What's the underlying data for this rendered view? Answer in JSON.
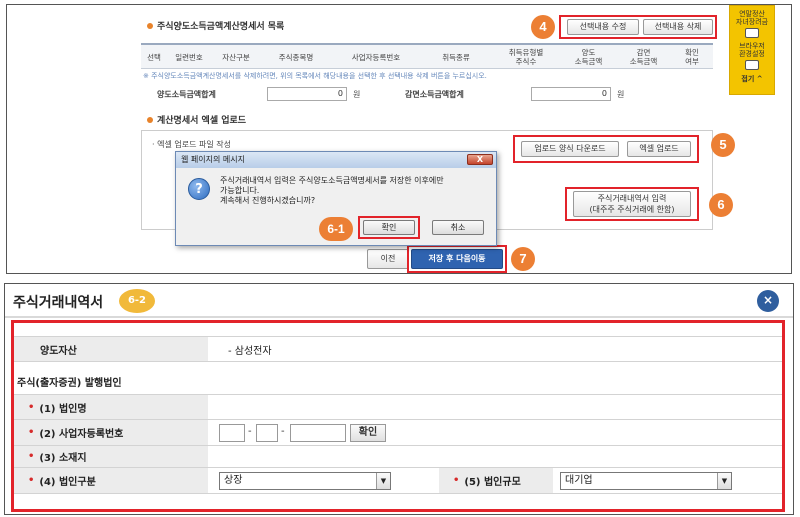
{
  "top": {
    "section1_title": "주식양도소득금액계산명세서 목록",
    "btn_edit": "선택내용 수정",
    "btn_delete": "선택내용 삭제",
    "columns": [
      "선택",
      "일련번호",
      "자산구분",
      "주식종목명",
      "사업자등록번호",
      "취득종류",
      "취득유형별\n주식수",
      "양도\n소득금액",
      "감면\n소득금액",
      "확인\n여부"
    ],
    "note1": "※ 주식양도소득금액계산명세서를 삭제하려면, 위의 목록에서 해당내용을 선택한 후 선택내용 삭제 버튼을 누르십시오.",
    "total_label": "양도소득금액합계",
    "total_value": "0",
    "total_unit": "원",
    "reduce_label": "감면소득금액합계",
    "reduce_value": "0",
    "reduce_unit": "원",
    "section2_title": "계산명세서 엑셀 업로드",
    "upload_line1": "· 엑셀 업로드 파일 작성",
    "btn_upload_form": "업로드 양식 다운로드",
    "btn_excel_upload": "엑셀 업로드",
    "btn_trade_input_l1": "주식거래내역서 입력",
    "btn_trade_input_l2": "(대주주 주식거래에 한함)",
    "btn_prev": "이전",
    "btn_save_next": "저장 후 다음이동",
    "markers": {
      "m4": "4",
      "m5": "5",
      "m6": "6",
      "m61": "6-1",
      "m7": "7"
    },
    "sidebar_top": "연말정산\n자녀장려금",
    "sidebar_mid": "브라우저\n환경설정",
    "sidebar_close": "접기 ^",
    "dialog": {
      "title": "웹 페이지의 메시지",
      "close": "X",
      "icon": "?",
      "message": "주식거래내역서 입력은 주식양도소득금액명세서를 저장한 이후에만\n가능합니다.\n계속해서 진행하시겠습니까?",
      "ok": "확인",
      "cancel": "취소"
    }
  },
  "bottom": {
    "title": "주식거래내역서",
    "badge": "6-2",
    "close_icon": "×",
    "asset_label": "양도자산",
    "asset_value": "- 삼성전자",
    "issuer_section": "주식(출자증권) 발행법인",
    "f1_label": "(1) 법인명",
    "f2_label": "(2) 사업자등록번호",
    "f2_check": "확인",
    "f2_dash": "-",
    "f3_label": "(3) 소재지",
    "f4_label": "(4) 법인구분",
    "f4_value": "상장",
    "f5_label": "(5) 법인규모",
    "f5_value": "대기업",
    "required_mark": "•"
  }
}
